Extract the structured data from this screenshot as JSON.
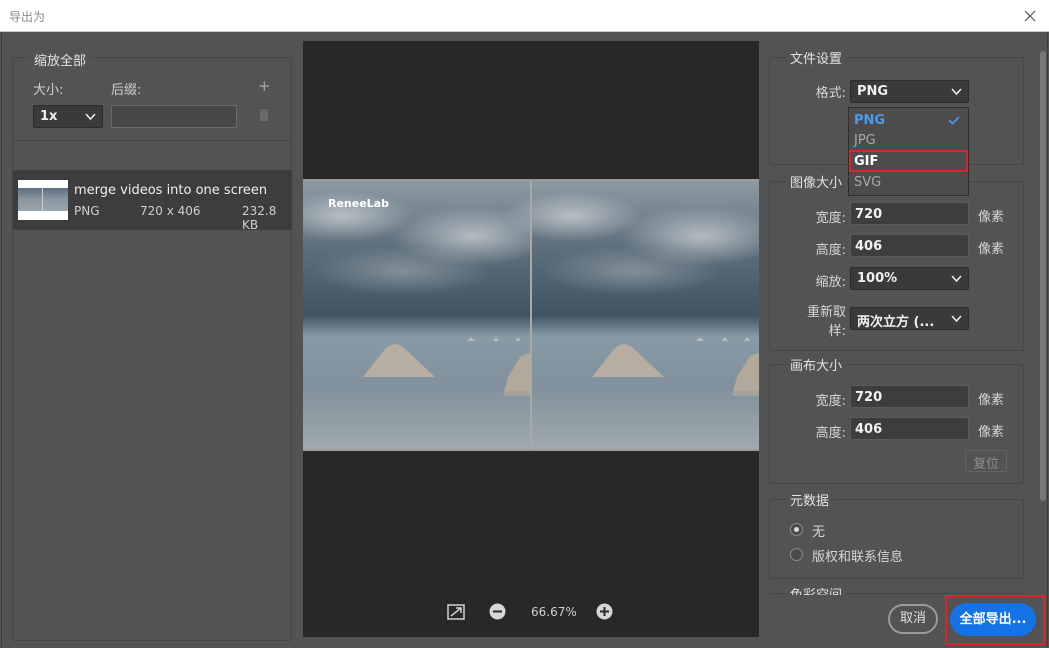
{
  "window": {
    "title": "导出为"
  },
  "left": {
    "scale_group": {
      "legend": "缩放全部",
      "size_label": "大小:",
      "suffix_label": "后缀:",
      "size_value": "1x",
      "suffix_value": ""
    },
    "asset": {
      "name": "merge videos into one screen",
      "format": "PNG",
      "dimensions": "720 x 406",
      "filesize": "232.8 KB"
    }
  },
  "preview": {
    "watermark": "ReneeLab",
    "zoom": "66.67%"
  },
  "right": {
    "file_settings": {
      "legend": "文件设置",
      "format_label": "格式:",
      "format_value": "PNG",
      "options": [
        {
          "label": "PNG",
          "state": "selected"
        },
        {
          "label": "JPG",
          "state": "normal"
        },
        {
          "label": "GIF",
          "state": "highlighted"
        },
        {
          "label": "SVG",
          "state": "normal"
        }
      ]
    },
    "image_size": {
      "legend": "图像大小",
      "width_label": "宽度:",
      "width_value": "720",
      "height_label": "高度:",
      "height_value": "406",
      "unit": "像素",
      "scale_label": "缩放:",
      "scale_value": "100%",
      "resample_label_1": "重新取",
      "resample_label_2": "样:",
      "resample_value": "两次立方 (..."
    },
    "canvas_size": {
      "legend": "画布大小",
      "width_label": "宽度:",
      "width_value": "720",
      "height_label": "高度:",
      "height_value": "406",
      "unit": "像素",
      "reset_label": "复位"
    },
    "metadata": {
      "legend": "元数据",
      "option_none": "无",
      "option_copyright": "版权和联系信息"
    },
    "next_legend": "色彩空间"
  },
  "footer": {
    "cancel_label": "取消",
    "export_label": "全部导出..."
  },
  "colors": {
    "accent": "#1473e6",
    "highlight": "#d9252c",
    "selected_option": "#4a9bf0"
  }
}
